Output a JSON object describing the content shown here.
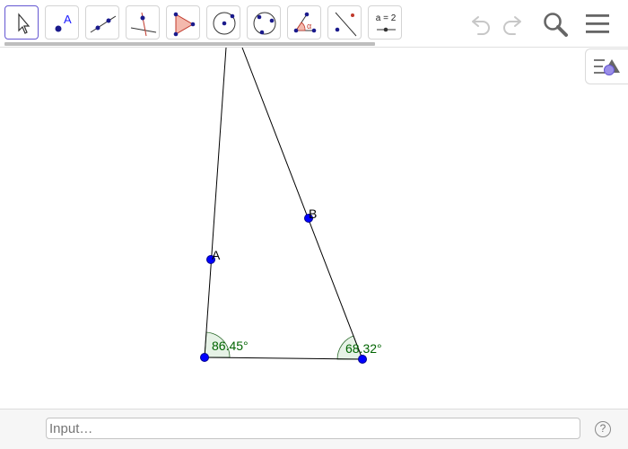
{
  "toolbar": {
    "tools": [
      {
        "name": "move-tool",
        "selected": true
      },
      {
        "name": "point-tool",
        "label": "A"
      },
      {
        "name": "line-tool"
      },
      {
        "name": "perpendicular-line-tool"
      },
      {
        "name": "polygon-tool"
      },
      {
        "name": "circle-with-center-through-point-tool"
      },
      {
        "name": "circle-through-3-points-tool"
      },
      {
        "name": "angle-tool",
        "label": "α"
      },
      {
        "name": "reflect-about-line-tool"
      },
      {
        "name": "slider-tool",
        "label": "a = 2"
      }
    ],
    "right_icons": [
      "undo-icon",
      "redo-icon",
      "search-icon",
      "menu-icon"
    ]
  },
  "construction": {
    "points": [
      {
        "label": "A"
      },
      {
        "label": "B"
      }
    ],
    "angles": [
      {
        "value_label": "86.45°"
      },
      {
        "value_label": "68.32°"
      }
    ]
  },
  "input_bar": {
    "placeholder": "Input…",
    "help_icon": "?"
  },
  "colors": {
    "accent": "#6557d2",
    "point": "#0000ff",
    "angle_text": "#006400",
    "angle_fill": "#e6f2e6"
  }
}
